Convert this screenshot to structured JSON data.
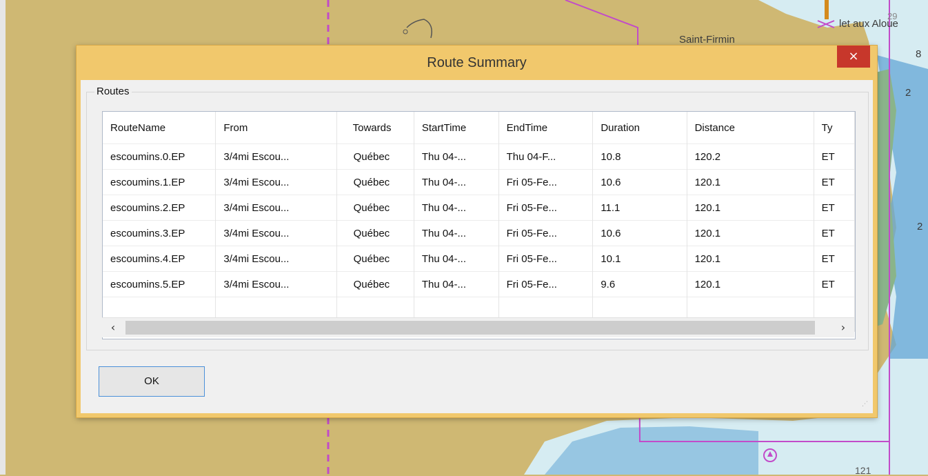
{
  "map": {
    "labels": {
      "saint_firmin": "Saint-Firmin",
      "ilet": "let aux Aloue",
      "n29": "29",
      "n8": "8",
      "n2a": "2",
      "n2b": "2",
      "n121": "121"
    }
  },
  "dialog": {
    "title": "Route Summary",
    "close_icon": "×",
    "group_label": "Routes",
    "ok_label": "OK"
  },
  "table": {
    "columns": [
      "RouteName",
      "From",
      "Towards",
      "StartTime",
      "EndTime",
      "Duration",
      "Distance",
      "Ty"
    ],
    "rows": [
      [
        "escoumins.0.EP",
        "3/4mi Escou...",
        "Québec",
        "Thu 04-...",
        "Thu 04-F...",
        "10.8",
        "120.2",
        "ET"
      ],
      [
        "escoumins.1.EP",
        "3/4mi Escou...",
        "Québec",
        "Thu 04-...",
        "Fri 05-Fe...",
        "10.6",
        "120.1",
        "ET"
      ],
      [
        "escoumins.2.EP",
        "3/4mi Escou...",
        "Québec",
        "Thu 04-...",
        "Fri 05-Fe...",
        "11.1",
        "120.1",
        "ET"
      ],
      [
        "escoumins.3.EP",
        "3/4mi Escou...",
        "Québec",
        "Thu 04-...",
        "Fri 05-Fe...",
        "10.6",
        "120.1",
        "ET"
      ],
      [
        "escoumins.4.EP",
        "3/4mi Escou...",
        "Québec",
        "Thu 04-...",
        "Fri 05-Fe...",
        "10.1",
        "120.1",
        "ET"
      ],
      [
        "escoumins.5.EP",
        "3/4mi Escou...",
        "Québec",
        "Thu 04-...",
        "Fri 05-Fe...",
        "9.6",
        "120.1",
        "ET"
      ]
    ]
  },
  "scrollbar": {
    "left_icon": "‹",
    "right_icon": "›"
  },
  "colors": {
    "land": "#cfb873",
    "water": "#d6ecf2",
    "shallow": "#64a7d6",
    "titlebar": "#f1c86c",
    "close": "#c7372b"
  }
}
